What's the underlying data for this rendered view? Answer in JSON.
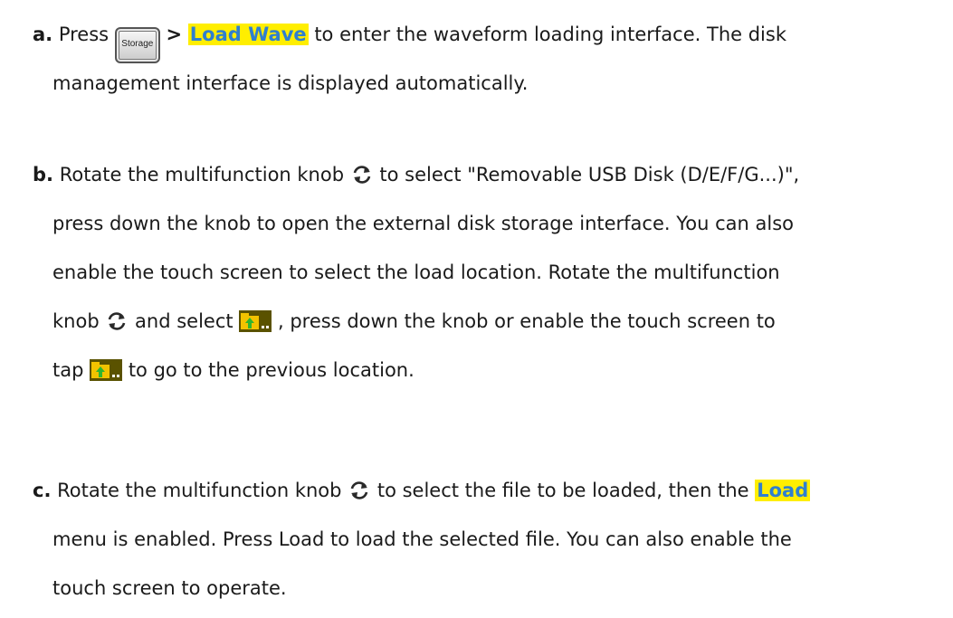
{
  "step_a": {
    "marker": "a.",
    "press": "Press",
    "button_label": "Storage",
    "gt": ">",
    "highlight": "Load Wave",
    "l1_rest": "to enter the waveform loading interface. The disk",
    "l2": "management interface is displayed automatically."
  },
  "step_b": {
    "marker": "b.",
    "l1_pre": "Rotate the multifunction knob",
    "l1_post": "to select \"Removable USB Disk (D/E/F/G...)\",",
    "l2": "press down the knob to open the external disk storage interface. You can also",
    "l3": "enable the touch screen to select the load location. Rotate the multifunction",
    "l4_pre": "knob",
    "l4_mid": "and select",
    "l4_post": ", press down the knob or enable the touch screen to",
    "l5_pre": "tap",
    "l5_post": "to go to the previous location."
  },
  "step_c": {
    "marker": "c.",
    "l1_pre": "Rotate the multifunction knob",
    "l1_mid": "to select the file to be loaded, then the",
    "highlight": "Load",
    "l2": "menu is enabled. Press Load to load the selected file. You can also enable the",
    "l3": "touch screen to operate."
  },
  "icons": {
    "knob": "rotate-knob-icon",
    "folder": "folder-up-icon",
    "button": "storage-button-icon"
  },
  "colors": {
    "highlight_bg": "#ffee00",
    "highlight_text": "#2f7fcf",
    "body_text": "#1a1a1a"
  }
}
